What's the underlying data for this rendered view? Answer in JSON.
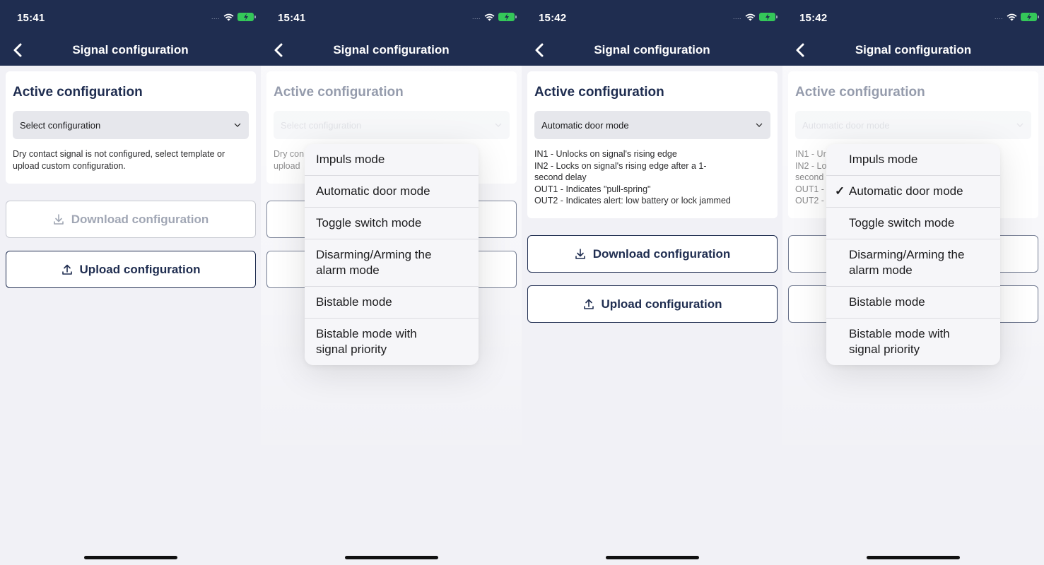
{
  "nav_title": "Signal configuration",
  "card_title": "Active configuration",
  "buttons": {
    "download": "Download configuration",
    "upload": "Upload configuration"
  },
  "screens": [
    {
      "time": "15:41",
      "select_value": "Select configuration",
      "description": "Dry contact signal is not configured, select template or\nupload custom configuration."
    },
    {
      "time": "15:41",
      "select_value": "Select configuration",
      "description": "Dry con                                           ate or\nupload"
    },
    {
      "time": "15:42",
      "select_value": "Automatic door mode",
      "description": "IN1 - Unlocks on signal's rising edge\nIN2 - Locks on signal's rising edge after a 1-\nsecond delay\nOUT1 - Indicates \"pull-spring\"\nOUT2 - Indicates alert: low battery or lock jammed"
    },
    {
      "time": "15:42",
      "select_value": "Automatic door mode",
      "description": "IN1 - Ur\nIN2 - Lo\nsecond\nOUT1 -\nOUT2 -                                                    d"
    }
  ],
  "menu_options": [
    "Impuls mode",
    "Automatic door mode",
    "Toggle switch mode",
    "Disarming/Arming the alarm mode",
    "Bistable mode",
    "Bistable mode with signal priority"
  ],
  "selected_option_index": 1,
  "icons": {
    "back": "chevron-left-icon",
    "dropdown": "chevron-down-icon",
    "download": "download-icon",
    "upload": "upload-icon",
    "wifi": "wifi-icon",
    "battery": "battery-charging-icon",
    "check": "checkmark-icon"
  },
  "colors": {
    "header": "#1f2d50",
    "accent": "#1f2d50",
    "battery": "#34c759",
    "background": "#f1f1f6"
  }
}
